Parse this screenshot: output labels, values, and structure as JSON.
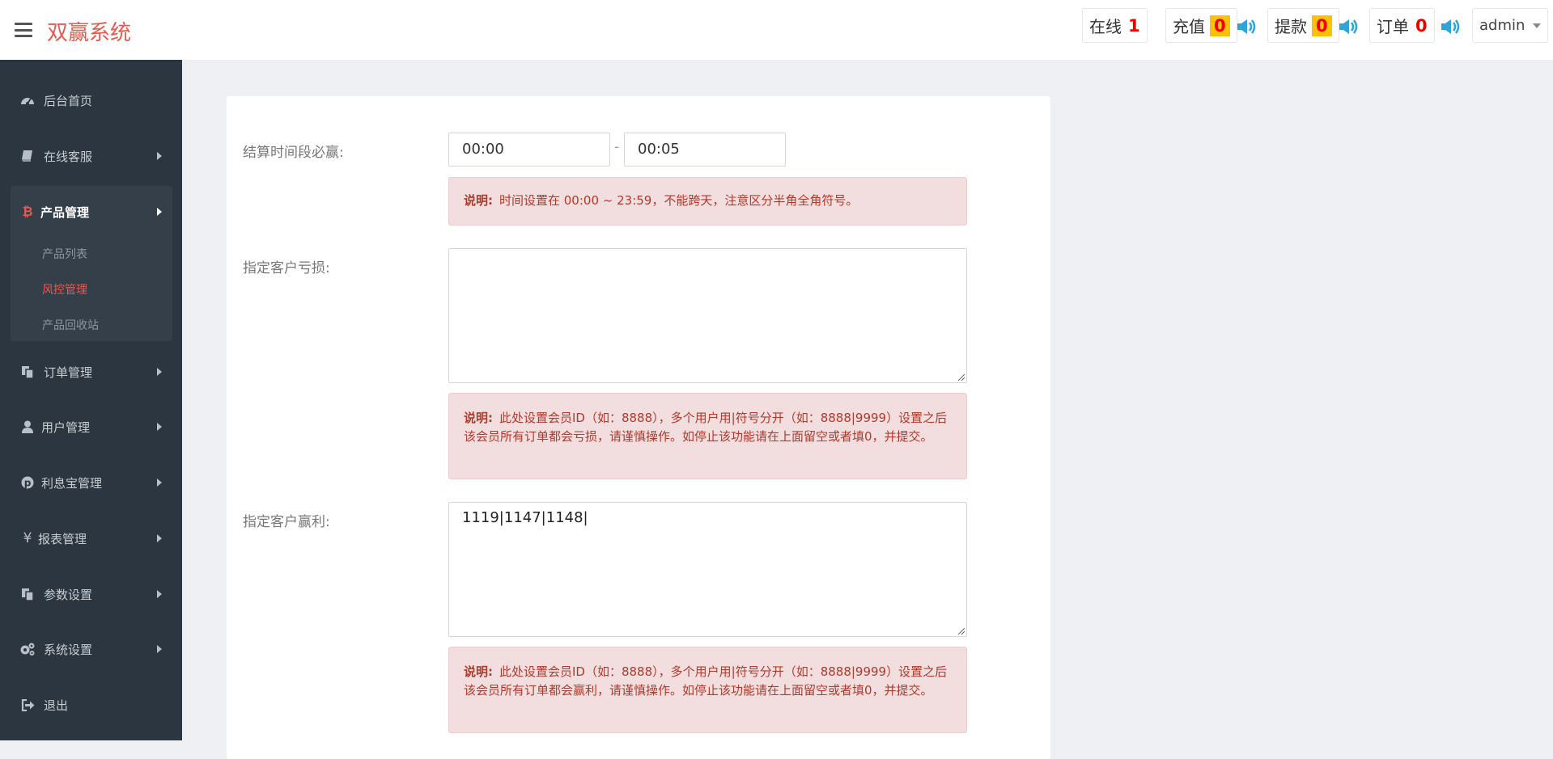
{
  "header": {
    "brand": "双赢系统",
    "stats": [
      {
        "label": "在线",
        "count": "1"
      },
      {
        "label": "充值",
        "count": "0"
      },
      {
        "label": "提款",
        "count": "0"
      },
      {
        "label": "订单",
        "count": "0"
      }
    ],
    "user": "admin"
  },
  "sidebar": {
    "items": [
      {
        "label": "后台首页",
        "icon": "dashboard-icon"
      },
      {
        "label": "在线客服",
        "icon": "book-icon"
      },
      {
        "label": "产品管理",
        "icon": "bitcoin-icon"
      },
      {
        "label": "订单管理",
        "icon": "copy-icon"
      },
      {
        "label": "用户管理",
        "icon": "user-icon"
      },
      {
        "label": "利息宝管理",
        "icon": "pinterest-icon"
      },
      {
        "label": "报表管理",
        "icon": "yen-icon"
      },
      {
        "label": "参数设置",
        "icon": "copy-icon"
      },
      {
        "label": "系统设置",
        "icon": "cogs-icon"
      },
      {
        "label": "退出",
        "icon": "sign-out-icon"
      }
    ],
    "submenu": [
      "产品列表",
      "风控管理",
      "产品回收站"
    ]
  },
  "form": {
    "time_label": "结算时间段必赢:",
    "time_start": "00:00",
    "time_end": "00:05",
    "time_separator": "-",
    "time_note_title": "说明:",
    "time_note": "时间设置在 00:00 ~ 23:59，不能跨天，注意区分半角全角符号。",
    "loss_label": "指定客户亏损:",
    "loss_value": "",
    "loss_note_title": "说明:",
    "loss_note": "此处设置会员ID（如：8888），多个用户用|符号分开（如：8888|9999）设置之后该会员所有订单都会亏损，请谨慎操作。如停止该功能请在上面留空或者填0，并提交。",
    "win_label": "指定客户赢利:",
    "win_value": "1119|1147|1148|",
    "win_note_title": "说明:",
    "win_note": "此处设置会员ID（如：8888），多个用户用|符号分开（如：8888|9999）设置之后该会员所有订单都会赢利，请谨慎操作。如停止该功能请在上面留空或者填0，并提交。"
  },
  "colors": {
    "brand": "#e8584f",
    "sidebar_bg": "#2c3640",
    "badge_yellow": "#ffc000",
    "note_bg": "#f2dede",
    "note_text": "#b03a2e"
  }
}
